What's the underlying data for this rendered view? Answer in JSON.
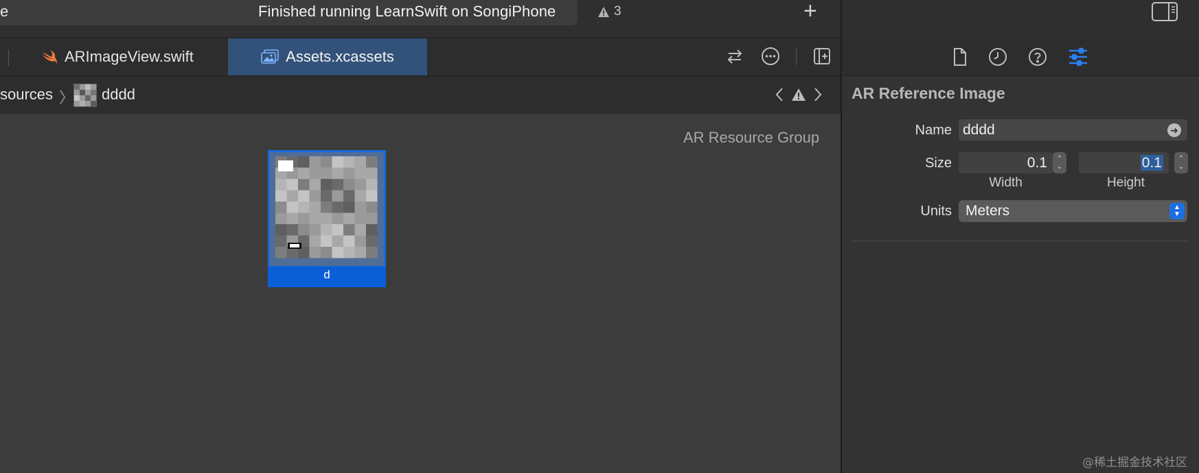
{
  "toolbar": {
    "left_fragment": "e",
    "status": "Finished running LearnSwift on SongiPhone",
    "warning_count": "3",
    "add_symbol": "+"
  },
  "tabs": [
    {
      "label": "ARImageView.swift",
      "icon": "swift-icon",
      "active": false
    },
    {
      "label": "Assets.xcassets",
      "icon": "image-assets-icon",
      "active": true
    }
  ],
  "breadcrumb": {
    "group": "sources",
    "separator": "〉",
    "item": "dddd"
  },
  "canvas": {
    "group_label": "AR Resource Group",
    "asset_name": "d"
  },
  "inspector": {
    "title": "AR Reference Image",
    "name_label": "Name",
    "name_value": "dddd",
    "size_label": "Size",
    "width_value": "0.1",
    "height_value": "0.1",
    "width_caption": "Width",
    "height_caption": "Height",
    "units_label": "Units",
    "units_value": "Meters"
  },
  "watermark": "@稀土掘金技术社区",
  "colors": {
    "accent": "#1a6ad9",
    "active_tab": "#33527a",
    "selected_inspector_icon": "#2b7ff0"
  }
}
